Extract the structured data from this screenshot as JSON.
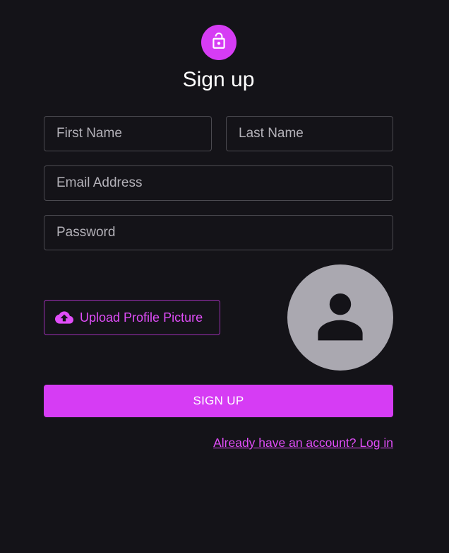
{
  "header": {
    "title": "Sign up",
    "icon": "lock-open-icon"
  },
  "form": {
    "first_name": {
      "placeholder": "First Name",
      "value": ""
    },
    "last_name": {
      "placeholder": "Last Name",
      "value": ""
    },
    "email": {
      "placeholder": "Email Address",
      "value": ""
    },
    "password": {
      "placeholder": "Password",
      "value": ""
    }
  },
  "upload": {
    "label": "Upload Profile Picture",
    "icon": "cloud-upload-icon"
  },
  "avatar": {
    "icon": "person-icon"
  },
  "submit": {
    "label": "SIGN UP"
  },
  "footer": {
    "login_link": "Already have an account? Log in"
  },
  "colors": {
    "background": "#141318",
    "accent": "#d63cf4",
    "accent_text": "#e04df8",
    "field_border": "#4b4a50",
    "placeholder": "#b3b1b8",
    "avatar_bg": "#aaa8b0",
    "avatar_fg": "#141318"
  }
}
